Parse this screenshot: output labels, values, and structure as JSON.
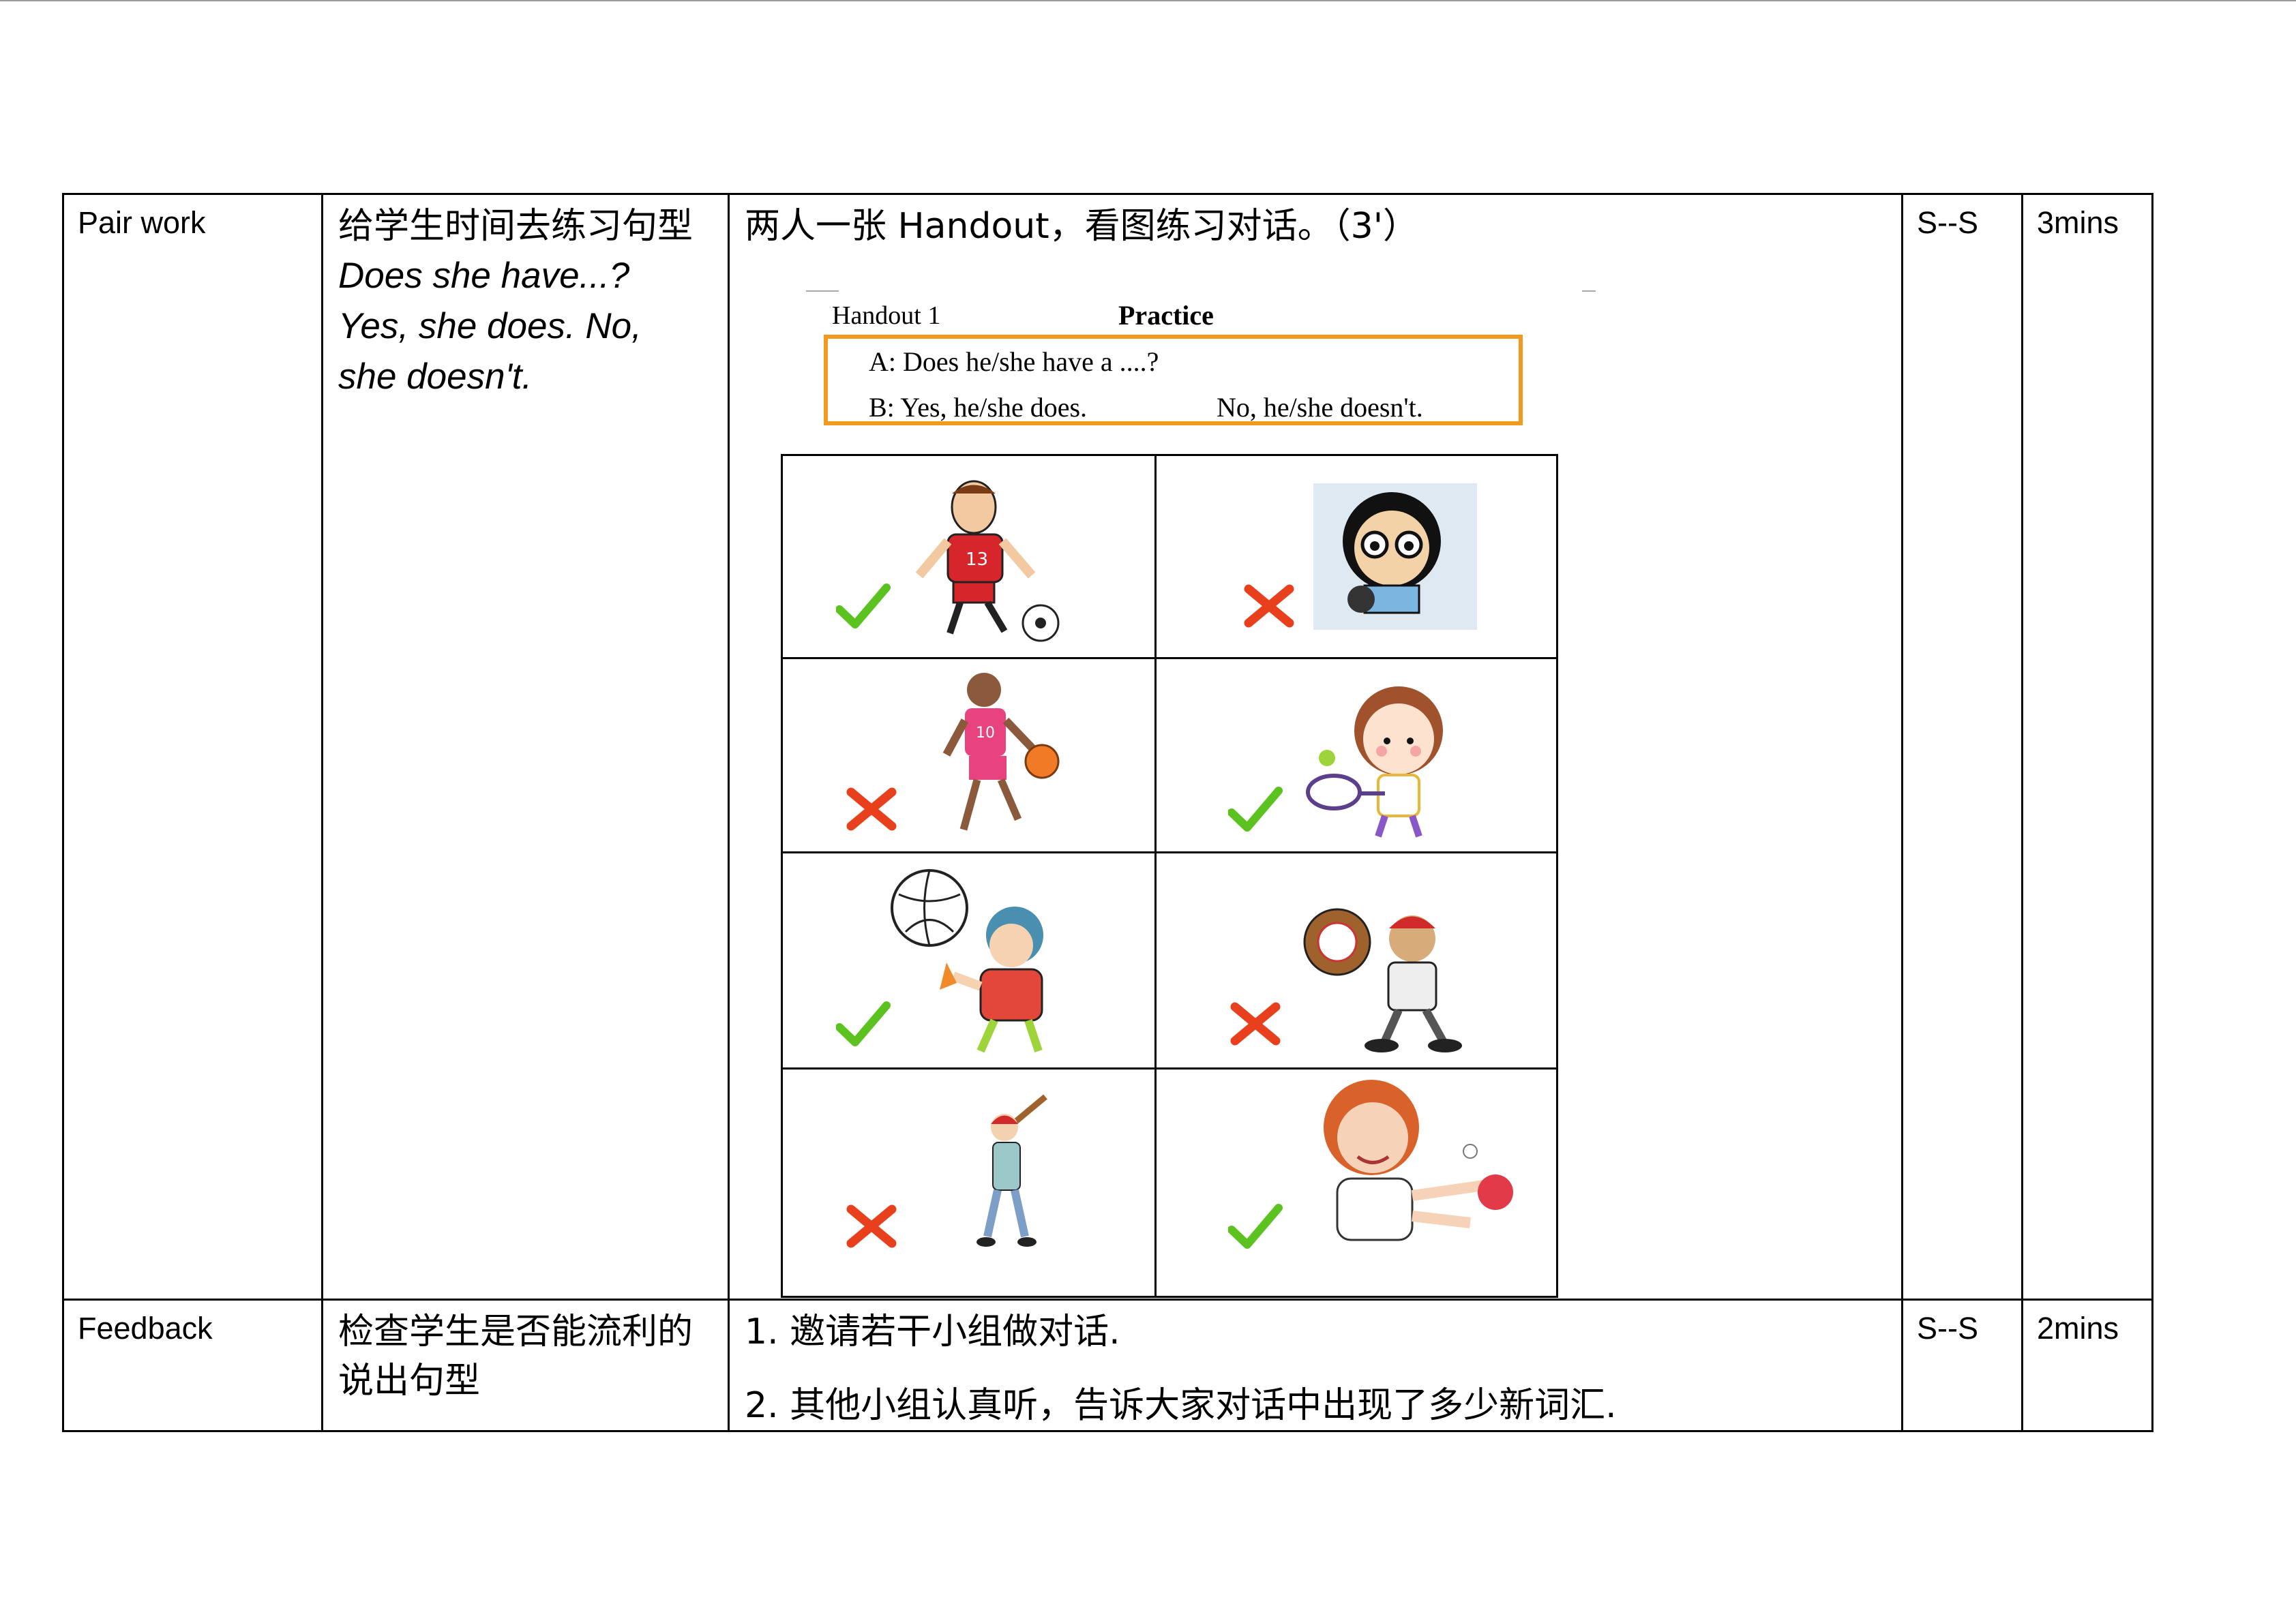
{
  "rows": [
    {
      "activity": "Pair work",
      "purpose_zh": "给学生时间去练习句型",
      "purpose_lines": [
        "Does she have...?",
        "Yes, she does. No,",
        "she doesn't."
      ],
      "procedure_intro": "两人一张 Handout，看图练习对话。（3'）",
      "interaction": "S--S",
      "time": "3mins"
    },
    {
      "activity": "Feedback",
      "purpose_zh": "检查学生是否能流利的说出句型",
      "procedure_steps": [
        "1. 邀请若干小组做对话.",
        "2. 其他小组认真听，告诉大家对话中出现了多少新词汇."
      ],
      "interaction": "S--S",
      "time": "2mins"
    }
  ],
  "handout": {
    "title": "Handout 1",
    "heading": "Practice",
    "line_a": "A: Does he/she have a ....?",
    "line_b_yes": "B: Yes, he/she does.",
    "line_b_no": "No, he/she doesn't.",
    "border_color": "#f29a1d",
    "cells": [
      {
        "picture": "soccer-player",
        "mark": "check"
      },
      {
        "picture": "girl-with-ball",
        "mark": "cross"
      },
      {
        "picture": "basketball-player",
        "mark": "cross"
      },
      {
        "picture": "tennis-girl",
        "mark": "check"
      },
      {
        "picture": "volleyball-player",
        "mark": "check"
      },
      {
        "picture": "baseball-catcher",
        "mark": "cross"
      },
      {
        "picture": "baseball-batter",
        "mark": "cross"
      },
      {
        "picture": "table-tennis-player",
        "mark": "check"
      }
    ],
    "mark_colors": {
      "check": "#5cc21f",
      "cross": "#e8401c"
    }
  }
}
